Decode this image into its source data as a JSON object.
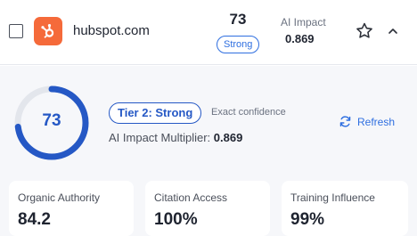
{
  "row": {
    "domain": "hubspot.com",
    "score": "73",
    "strength_badge": "Strong",
    "ai_impact_label": "AI Impact",
    "ai_impact_value": "0.869",
    "logo_color": "#f56a3a",
    "icons": {
      "logo": "hubspot-logo",
      "favorite": "star-icon",
      "collapse": "chevron-up-icon",
      "checkbox": "checkbox"
    }
  },
  "detail": {
    "ring_score": "73",
    "ring_progress": 0.73,
    "tier_label": "Tier 2: Strong",
    "confidence_label": "Exact confidence",
    "multiplier_label": "AI Impact Multiplier:",
    "multiplier_value": "0.869",
    "refresh_label": "Refresh",
    "refresh_icon": "refresh-icon",
    "accent_color": "#2558c5"
  },
  "metrics": [
    {
      "label": "Organic Authority",
      "value": "84.2"
    },
    {
      "label": "Citation Access",
      "value": "100%"
    },
    {
      "label": "Training Influence",
      "value": "99%"
    }
  ]
}
